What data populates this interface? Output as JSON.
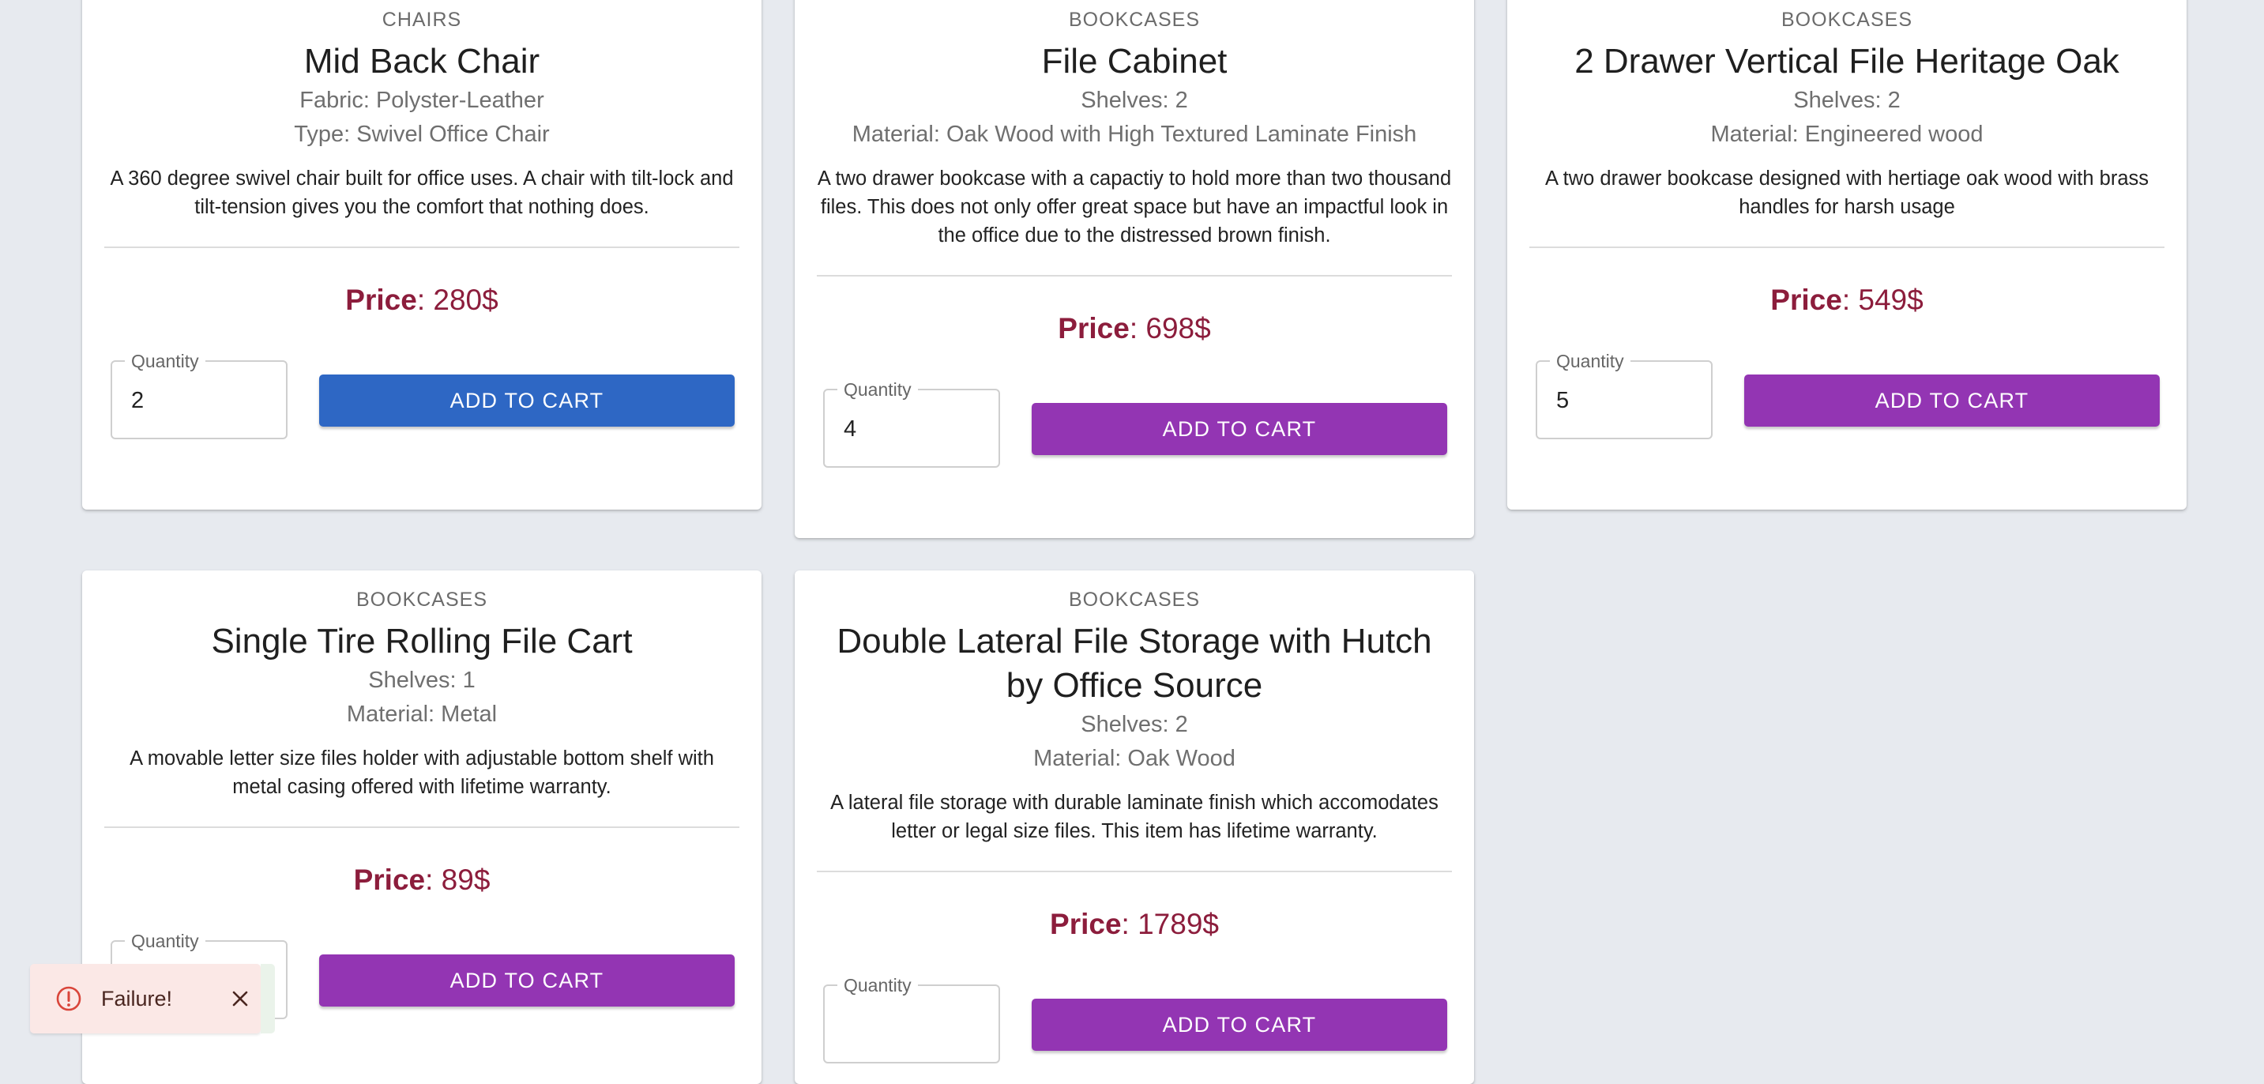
{
  "colors": {
    "price": "#8c1d3c",
    "button_purple": "#9335b3",
    "button_blue": "#2e67c4",
    "toast_bg": "#fbe8e6"
  },
  "cards": [
    {
      "category": "CHAIRS",
      "title": "Mid Back Chair",
      "specs": [
        "Fabric: Polyster-Leather",
        "Type: Swivel Office Chair"
      ],
      "description": "A 360 degree swivel chair built for office uses. A chair with tilt-lock and tilt-tension gives you the comfort that nothing does.",
      "price_label": "Price",
      "price_value": ": 280$",
      "quantity_label": "Quantity",
      "quantity_value": "2",
      "button_label": "ADD TO CART",
      "button_state": "focused"
    },
    {
      "category": "BOOKCASES",
      "title": "File Cabinet",
      "specs": [
        "Shelves: 2",
        "Material: Oak Wood with High Textured Laminate Finish"
      ],
      "description": "A two drawer bookcase with a capactiy to hold more than two thousand files. This does not only offer great space but have an impactful look in the office due to the distressed brown finish.",
      "price_label": "Price",
      "price_value": ": 698$",
      "quantity_label": "Quantity",
      "quantity_value": "4",
      "button_label": "ADD TO CART",
      "button_state": "default"
    },
    {
      "category": "BOOKCASES",
      "title": "2 Drawer Vertical File Heritage Oak",
      "specs": [
        "Shelves: 2",
        "Material: Engineered wood"
      ],
      "description": "A two drawer bookcase designed with hertiage oak wood with brass handles for harsh usage",
      "price_label": "Price",
      "price_value": ": 549$",
      "quantity_label": "Quantity",
      "quantity_value": "5",
      "button_label": "ADD TO CART",
      "button_state": "default"
    },
    {
      "category": "BOOKCASES",
      "title": "Single Tire Rolling File Cart",
      "specs": [
        "Shelves: 1",
        "Material: Metal"
      ],
      "description": "A movable letter size files holder with adjustable bottom shelf with metal casing offered with lifetime warranty.",
      "price_label": "Price",
      "price_value": ": 89$",
      "quantity_label": "Quantity",
      "quantity_value": "",
      "button_label": "ADD TO CART",
      "button_state": "default"
    },
    {
      "category": "BOOKCASES",
      "title": "Double Lateral File Storage with Hutch by Office Source",
      "specs": [
        "Shelves: 2",
        "Material: Oak Wood"
      ],
      "description": "A lateral file storage with durable laminate finish which accomodates letter or legal size files. This item has lifetime warranty.",
      "price_label": "Price",
      "price_value": ": 1789$",
      "quantity_label": "Quantity",
      "quantity_value": "",
      "button_label": "ADD TO CART",
      "button_state": "default"
    }
  ],
  "toast": {
    "message": "Failure!",
    "icon": "error-circle-icon",
    "close_icon": "close-icon"
  }
}
